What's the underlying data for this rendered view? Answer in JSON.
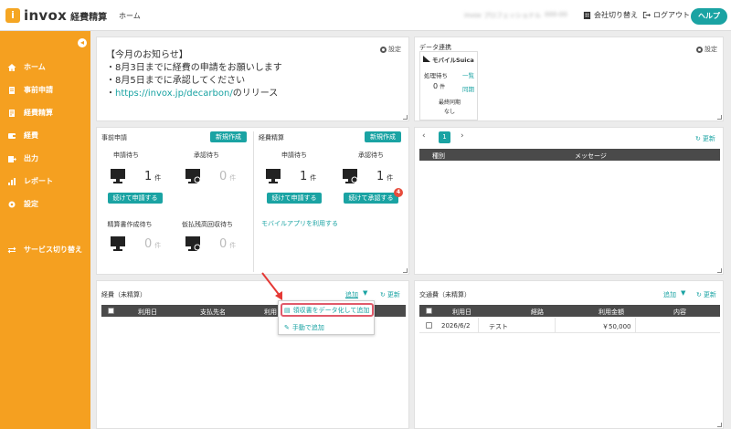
{
  "header": {
    "logo_text": "invox",
    "logo_sub": "経費精算",
    "home": "ホーム",
    "user_name": "invox プロフェッショナル",
    "user_id": "000-00",
    "company_switch": "会社切り替え",
    "logout": "ログアウト",
    "help": "ヘルプ"
  },
  "sidebar": {
    "items": [
      {
        "label": "ホーム",
        "icon": "home-icon"
      },
      {
        "label": "事前申請",
        "icon": "document-icon"
      },
      {
        "label": "経費精算",
        "icon": "receipt-icon"
      },
      {
        "label": "経費",
        "icon": "wallet-icon"
      },
      {
        "label": "出力",
        "icon": "export-icon"
      },
      {
        "label": "レポート",
        "icon": "chart-icon"
      },
      {
        "label": "設定",
        "icon": "gear-icon"
      },
      {
        "label": "サービス切り替え",
        "icon": "swap-icon"
      }
    ]
  },
  "notice": {
    "title": "【今月のお知らせ】",
    "settings": "設定",
    "line1": "・8月3日までに経費の申請をお願いします",
    "line2": "・8月5日までに承認してください",
    "line3_prefix": "・",
    "line3_link": "https://invox.jp/decarbon/",
    "line3_suffix": "のリリース"
  },
  "data_link": {
    "title": "データ連携",
    "settings": "設定",
    "card_title": "モバイルSuica",
    "pending_label": "処理待ち",
    "list_link": "一覧",
    "pending_count": "0",
    "unit": "件",
    "sync_link": "同期",
    "last_sync_label": "最終同期",
    "last_sync_value": "なし"
  },
  "pre_request": {
    "title": "事前申請",
    "new_button": "新規作成",
    "pending_label": "申請待ち",
    "pending_count": "1",
    "approval_label": "承認待ち",
    "approval_count": "0",
    "continue_button": "続けて申請する",
    "settlement_label": "精算書作成待ち",
    "settlement_count": "0",
    "advance_label": "仮払残高回収待ち",
    "advance_count": "0",
    "unit": "件"
  },
  "expense_settle": {
    "title": "経費精算",
    "new_button": "新規作成",
    "pending_label": "申請待ち",
    "pending_count": "1",
    "approval_label": "承認待ち",
    "approval_count": "1",
    "continue_request": "続けて申請する",
    "continue_approve": "続けて承認する",
    "badge": "4",
    "mobile_link": "モバイルアプリを利用する",
    "unit": "件"
  },
  "messages": {
    "page": "1",
    "refresh": "更新",
    "col_type": "種別",
    "col_message": "メッセージ"
  },
  "expenses": {
    "title": "経費（未精算）",
    "add": "追加",
    "refresh": "更新",
    "col_date": "利用日",
    "col_payee": "支払先名",
    "col_partial": "利用",
    "menu_receipt": "領収書をデータ化して追加",
    "menu_manual": "手動で追加"
  },
  "transport": {
    "title": "交通費（未精算）",
    "add": "追加",
    "refresh": "更新",
    "col_date": "利用日",
    "col_route": "経路",
    "col_amount": "利用金額",
    "col_content": "内容",
    "rows": [
      {
        "date": "2026/6/2",
        "route": "テスト",
        "amount": "￥50,000",
        "content": ""
      }
    ]
  }
}
